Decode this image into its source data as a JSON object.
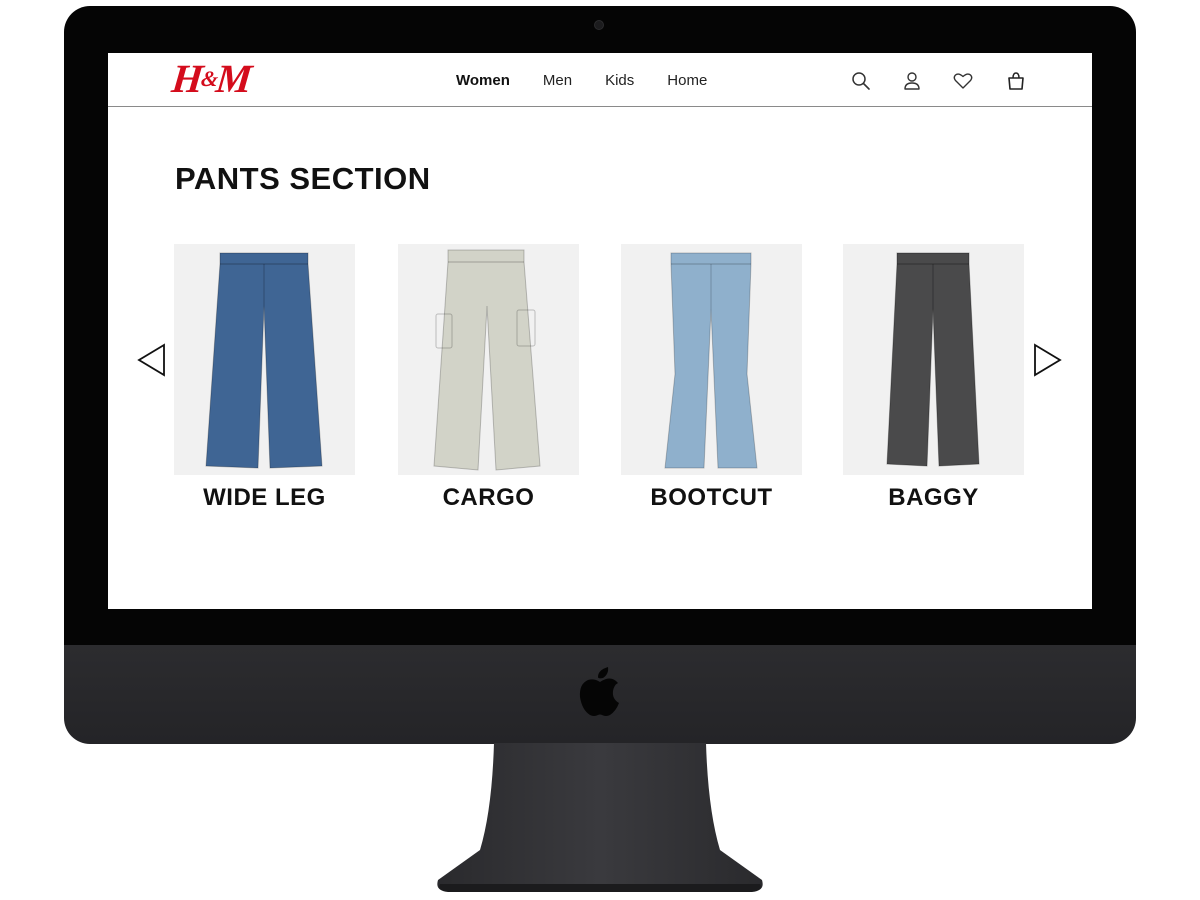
{
  "brand": {
    "logo_text_left": "H",
    "logo_amp": "&",
    "logo_text_right": "M",
    "color": "#d40c1c"
  },
  "nav": {
    "links": [
      {
        "label": "Women",
        "active": true
      },
      {
        "label": "Men",
        "active": false
      },
      {
        "label": "Kids",
        "active": false
      },
      {
        "label": "Home",
        "active": false
      }
    ],
    "icons": [
      "search-icon",
      "account-icon",
      "favorites-icon",
      "shopping-bag-icon"
    ]
  },
  "section": {
    "title": "PANTS SECTION"
  },
  "carousel": {
    "prev_icon": "triangle-left-icon",
    "next_icon": "triangle-right-icon",
    "products": [
      {
        "label": "WIDE LEG",
        "color": "#3f6594"
      },
      {
        "label": "CARGO",
        "color": "#d2d3c8"
      },
      {
        "label": "BOOTCUT",
        "color": "#8fb0cc"
      },
      {
        "label": "BAGGY",
        "color": "#4a4a4b"
      }
    ]
  },
  "device": {
    "logo_icon": "apple-logo-icon"
  }
}
